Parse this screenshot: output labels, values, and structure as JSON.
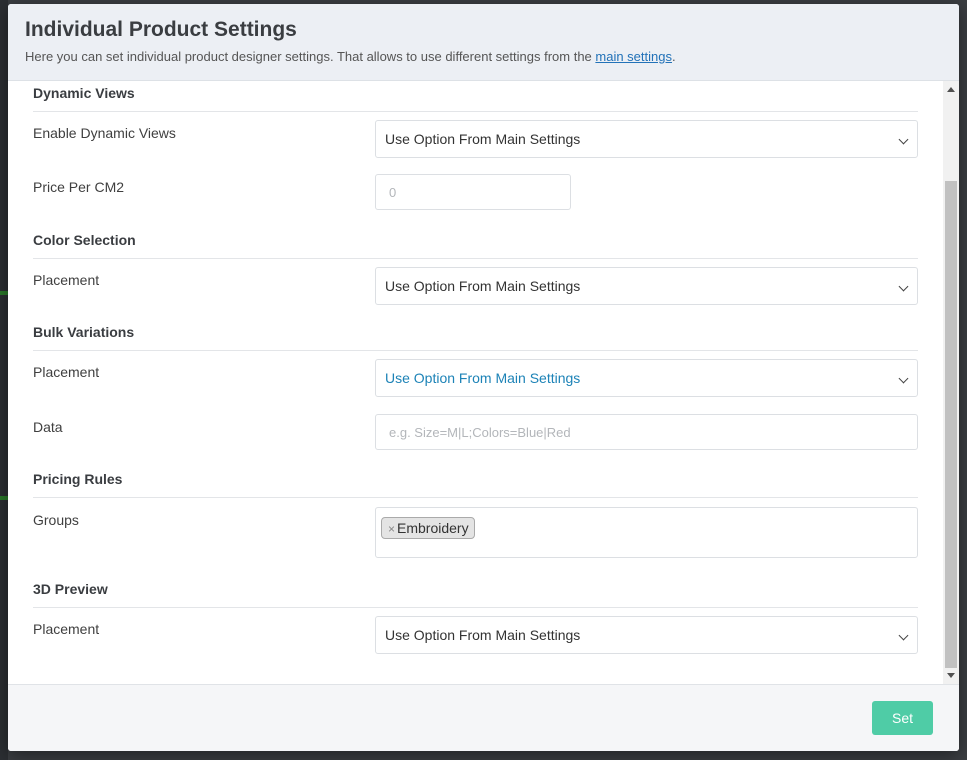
{
  "modal": {
    "title": "Individual Product Settings",
    "description": "Here you can set individual product designer settings. That allows to use different settings from the ",
    "description_link": "main settings",
    "description_end": "."
  },
  "sections": {
    "dynamic_views": {
      "title": "Dynamic Views",
      "enable_label": "Enable Dynamic Views",
      "enable_value": "Use Option From Main Settings",
      "price_label": "Price Per CM2",
      "price_placeholder": "0"
    },
    "color_selection": {
      "title": "Color Selection",
      "placement_label": "Placement",
      "placement_value": "Use Option From Main Settings"
    },
    "bulk_variations": {
      "title": "Bulk Variations",
      "placement_label": "Placement",
      "placement_value": "Use Option From Main Settings",
      "data_label": "Data",
      "data_placeholder": "e.g. Size=M|L;Colors=Blue|Red"
    },
    "pricing_rules": {
      "title": "Pricing Rules",
      "groups_label": "Groups",
      "group_tags": [
        "Embroidery"
      ],
      "tag_remove_symbol": "×"
    },
    "preview_3d": {
      "title": "3D Preview",
      "placement_label": "Placement",
      "placement_value": "Use Option From Main Settings"
    }
  },
  "footer": {
    "set_label": "Set"
  },
  "colors": {
    "accent": "#4fcca6",
    "link": "#2272b8",
    "active_select_text": "#1d83b7",
    "header_bg": "#eceff4"
  },
  "icons": {
    "select_chevron": "chevron-down-icon",
    "tag_remove": "close-icon",
    "scroll_up": "arrow-up-icon",
    "scroll_down": "arrow-down-icon"
  }
}
